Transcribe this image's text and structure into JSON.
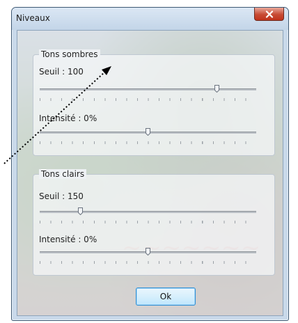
{
  "window": {
    "title": "Niveaux"
  },
  "groups": [
    {
      "title": "Tons sombres",
      "sliders": [
        {
          "label": "Seuil : 100",
          "value_fraction": 0.82
        },
        {
          "label": "Intensité : 0%",
          "value_fraction": 0.5
        }
      ]
    },
    {
      "title": "Tons clairs",
      "sliders": [
        {
          "label": "Seuil : 150",
          "value_fraction": 0.19
        },
        {
          "label": "Intensité : 0%",
          "value_fraction": 0.5
        }
      ]
    }
  ],
  "buttons": {
    "ok_label": "Ok",
    "close_glyph": "✕"
  },
  "colors": {
    "close_red": "#c74a33",
    "annotation": "#000000"
  },
  "icons": {
    "close": "close-icon",
    "slider_thumb": "slider-thumb-icon"
  }
}
